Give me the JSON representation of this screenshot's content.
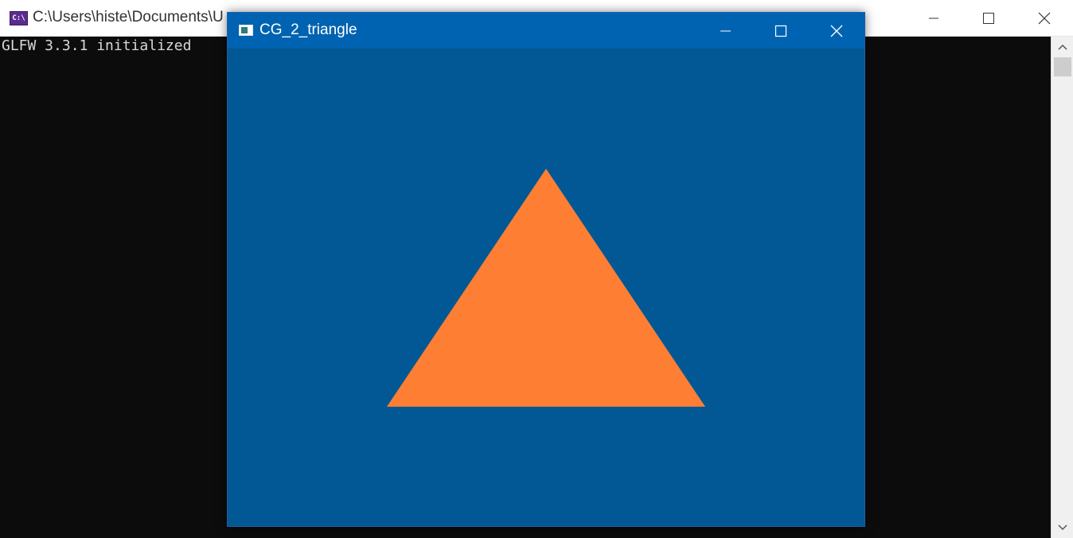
{
  "console": {
    "title": "C:\\Users\\histe\\Documents\\U",
    "icon_text": "C:\\",
    "output": "GLFW 3.3.1 initialized"
  },
  "gl_window": {
    "title": "CG_2_triangle",
    "background_color": "#015894",
    "triangle_color": "#fe7f33",
    "titlebar_color": "#0063b1"
  }
}
